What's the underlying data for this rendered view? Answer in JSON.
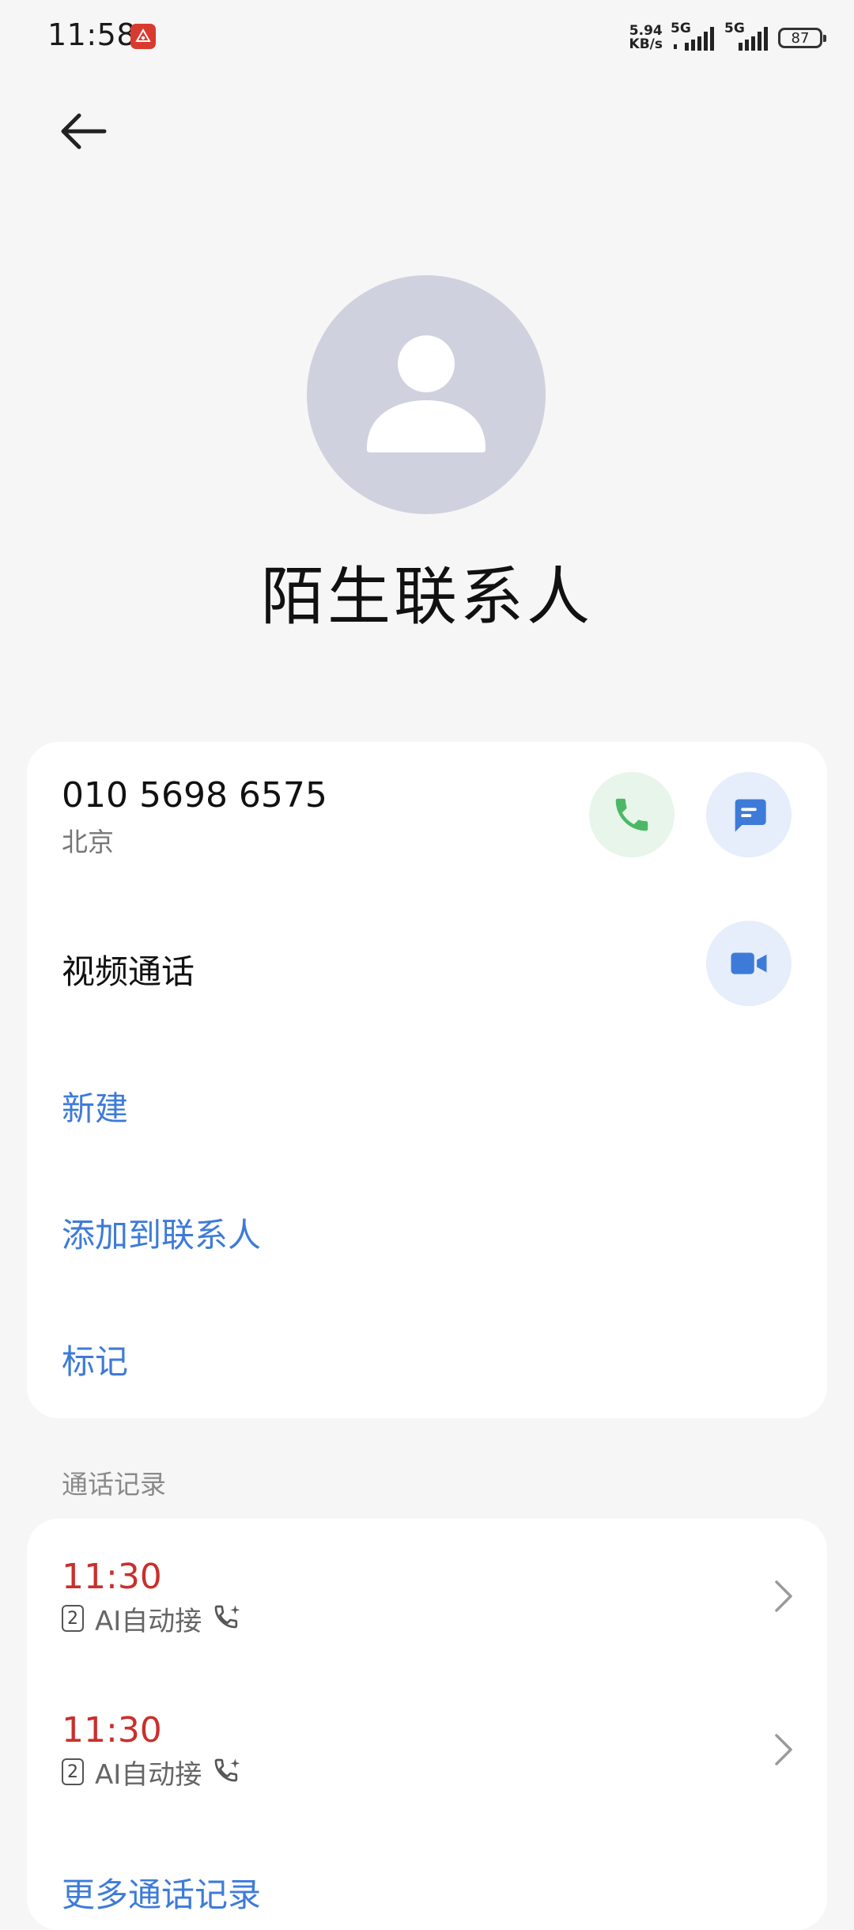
{
  "status_bar": {
    "time": "11:58",
    "net_speed_value": "5.94",
    "net_speed_unit": "KB/s",
    "sim1_network": "5G",
    "sim2_network": "5G",
    "battery": "87",
    "notification_icon": "app-notification-icon"
  },
  "contact": {
    "name": "陌生联系人",
    "phone": "010 5698 6575",
    "location": "北京"
  },
  "actions": {
    "video_call_label": "视频通话",
    "new_label": "新建",
    "add_to_contacts_label": "添加到联系人",
    "mark_label": "标记"
  },
  "call_log": {
    "section_title": "通话记录",
    "entries": [
      {
        "time": "11:30",
        "sim": "2",
        "label": "AI自动接"
      },
      {
        "time": "11:30",
        "sim": "2",
        "label": "AI自动接"
      }
    ],
    "more_label": "更多通话记录"
  },
  "colors": {
    "accent_blue": "#3e7bd8",
    "missed_red": "#c9302c",
    "call_green": "#4cb865",
    "avatar_bg": "#cfd1de"
  }
}
